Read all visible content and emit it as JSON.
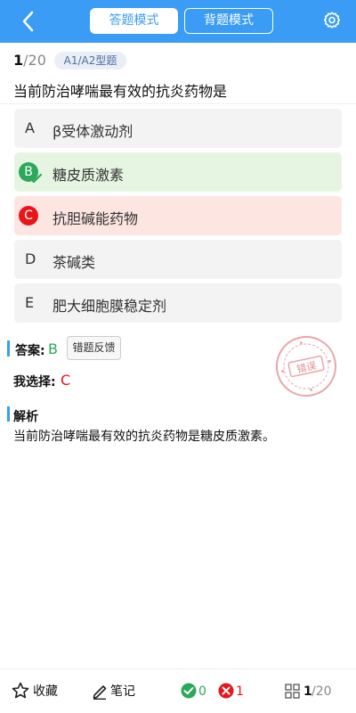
{
  "colors": {
    "primary": "#3a9cf4",
    "correct": "#2ba85a",
    "wrong": "#e8161b"
  },
  "header": {
    "mode_tabs": [
      "答题模式",
      "背题模式"
    ],
    "active_tab": "答题模式",
    "icons": {
      "back": "back-chevron-icon",
      "settings": "settings-gear-icon"
    }
  },
  "question": {
    "current": "1",
    "total": "/20",
    "type": "A1/A2型题",
    "text": "当前防治哮喘最有效的抗炎药物是",
    "options": [
      {
        "letter": "A",
        "text": "β受体激动剂",
        "state": "normal"
      },
      {
        "letter": "B",
        "text": "糖皮质激素",
        "state": "correct"
      },
      {
        "letter": "C",
        "text": "抗胆碱能药物",
        "state": "wrong"
      },
      {
        "letter": "D",
        "text": "茶碱类",
        "state": "normal"
      },
      {
        "letter": "E",
        "text": "肥大细胞膜稳定剂",
        "state": "normal"
      }
    ]
  },
  "answer": {
    "label": "答案:",
    "value": "B",
    "feedback_button": "错题反馈",
    "my_choice_label": "我选择:",
    "my_choice_value": "C",
    "stamp_text": "错误"
  },
  "analysis": {
    "title": "解析",
    "text": "当前防治哮喘最有效的抗炎药物是糖皮质激素。"
  },
  "bottom_bar": {
    "favorite": "收藏",
    "notes": "笔记",
    "correct_count": "0",
    "wrong_count": "1",
    "progress_current": "1",
    "progress_total": "/20"
  }
}
